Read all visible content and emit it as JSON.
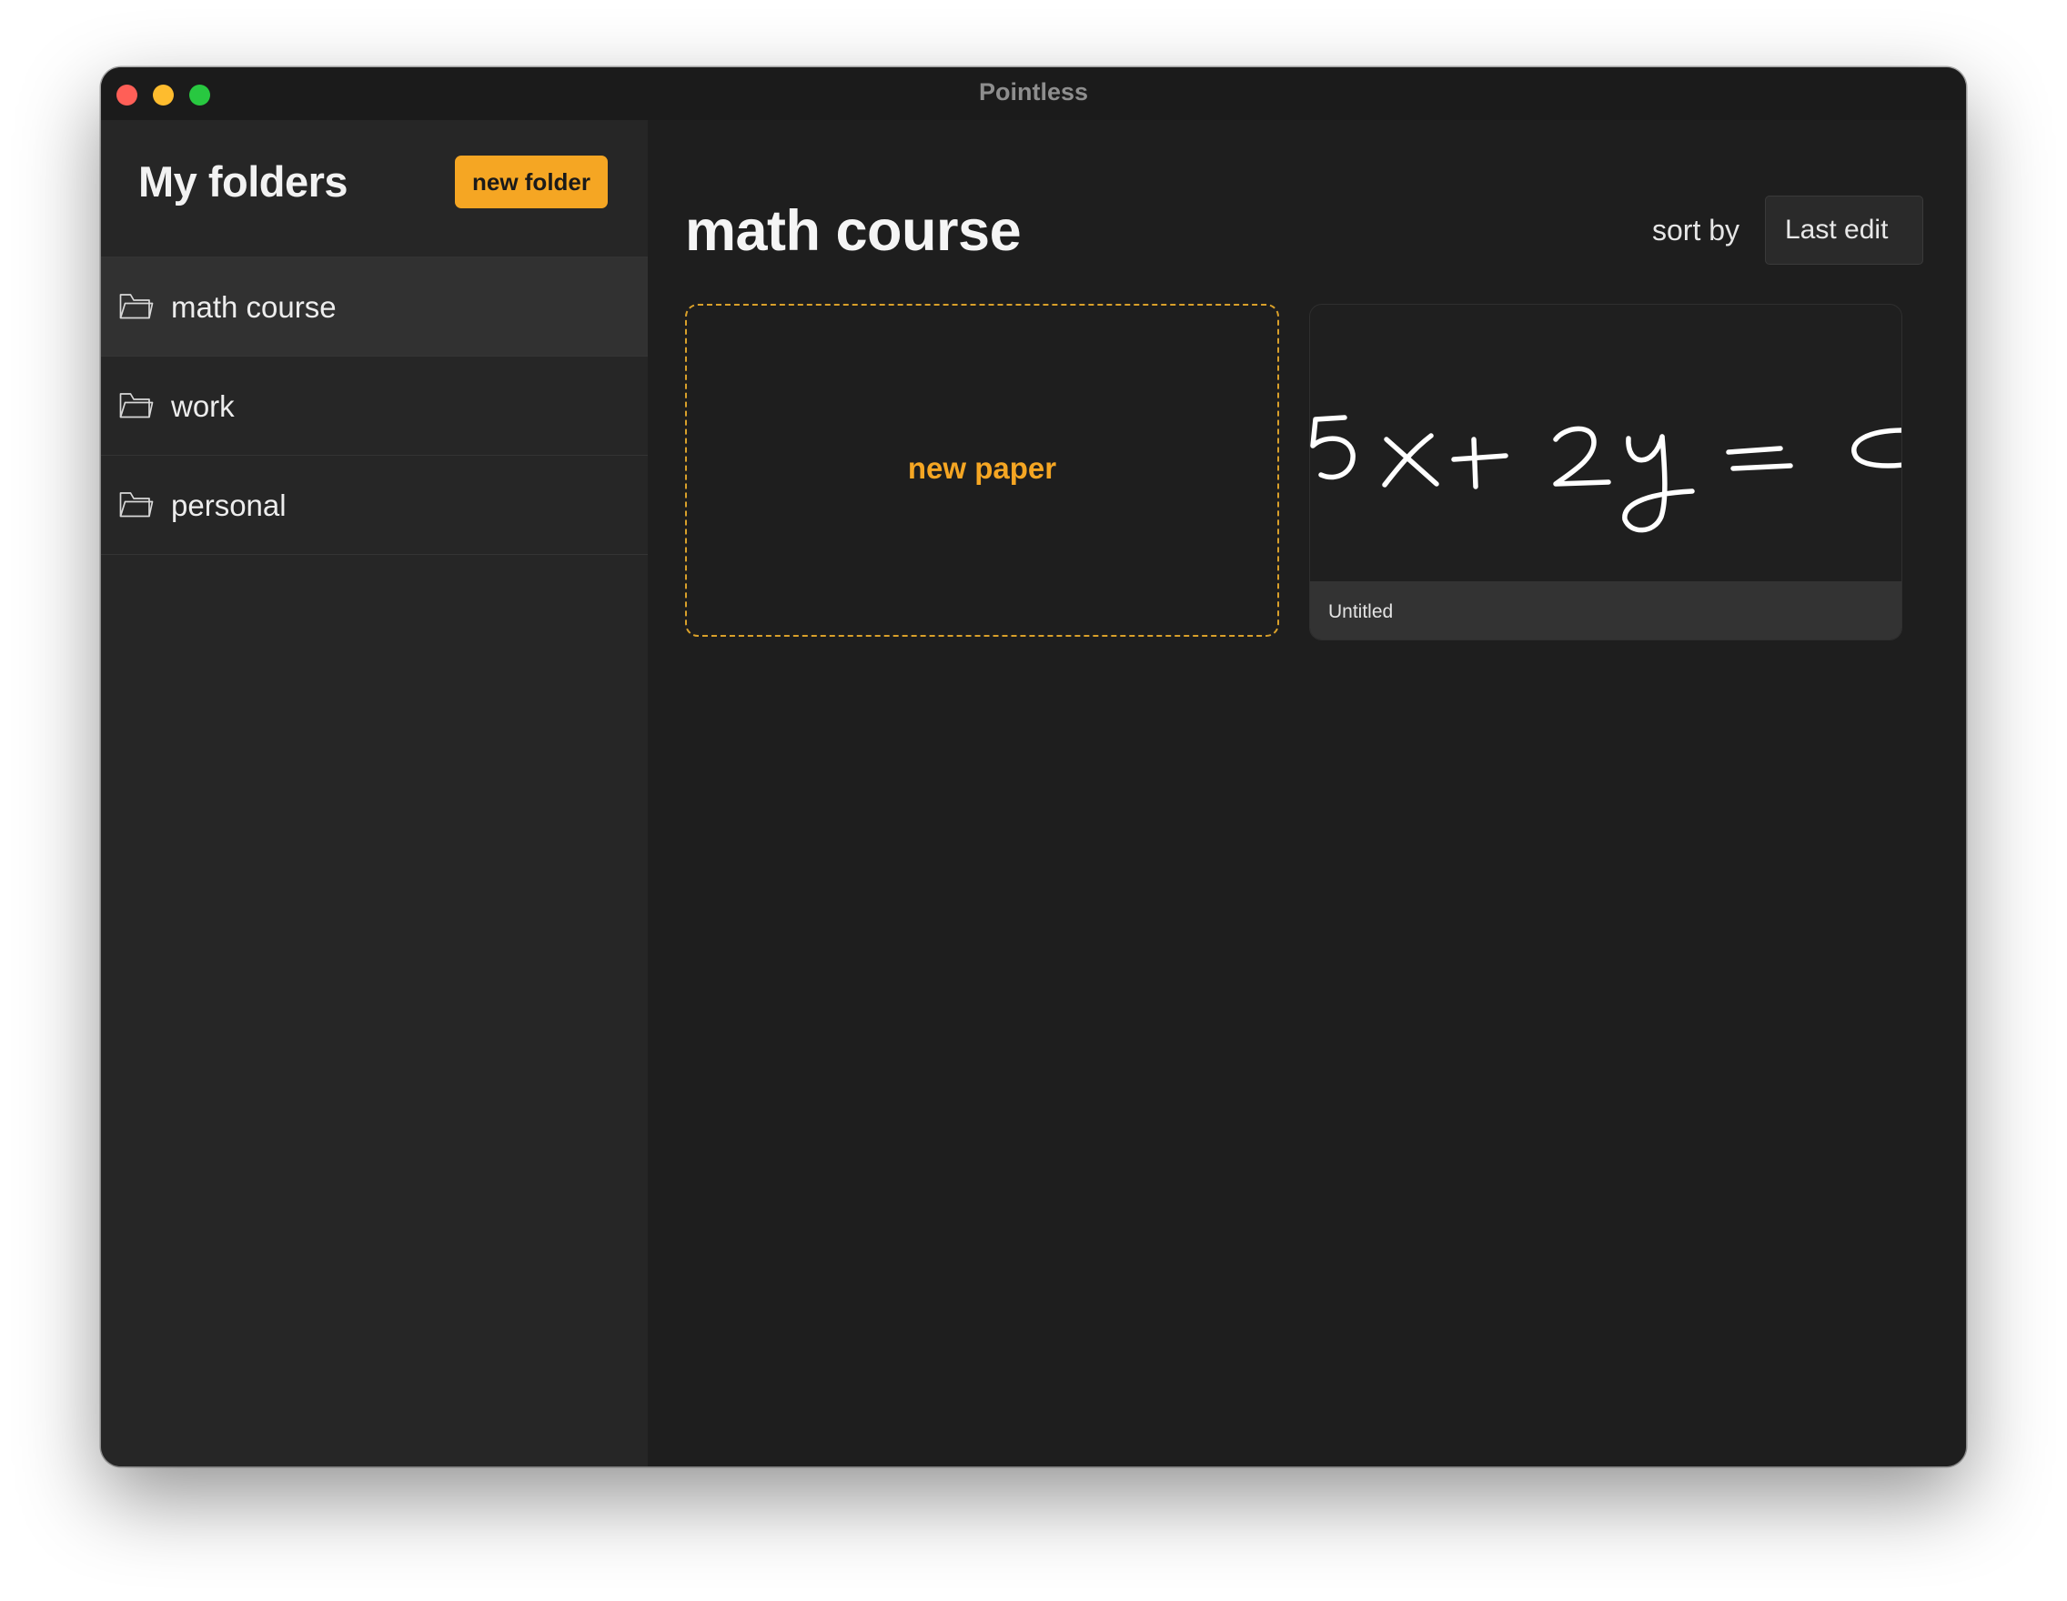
{
  "window": {
    "title": "Pointless"
  },
  "sidebar": {
    "title": "My folders",
    "new_folder_label": "new folder",
    "folders": [
      {
        "label": "math course",
        "selected": true,
        "icon": "folder-icon"
      },
      {
        "label": "work",
        "selected": false,
        "icon": "folder-icon"
      },
      {
        "label": "personal",
        "selected": false,
        "icon": "folder-icon"
      }
    ]
  },
  "main": {
    "title": "math course",
    "sort_label": "sort by",
    "sort_value": "Last edit",
    "new_paper_label": "new paper",
    "papers": [
      {
        "title": "Untitled",
        "preview": "handwritten equation 5x + 2y = c"
      }
    ]
  },
  "colors": {
    "accent": "#f5a623",
    "window_bg": "#1e1e1e",
    "sidebar_bg": "#262626",
    "selected_row": "#313131"
  }
}
